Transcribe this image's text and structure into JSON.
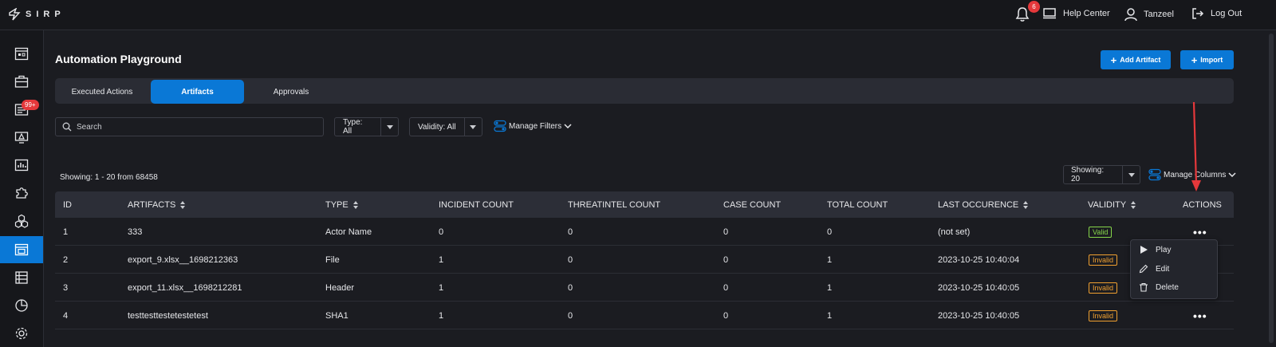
{
  "app": {
    "logo_text": "SIRP"
  },
  "topbar": {
    "notifications_count": "6",
    "help_label": "Help Center",
    "user_name": "Tanzeel",
    "logout_label": "Log Out"
  },
  "sidebar": {
    "badge": "99+"
  },
  "page": {
    "title": "Automation Playground",
    "add_artifact_label": "Add Artifact",
    "import_label": "Import"
  },
  "tabs": [
    {
      "label": "Executed Actions",
      "active": false
    },
    {
      "label": "Artifacts",
      "active": true
    },
    {
      "label": "Approvals",
      "active": false
    }
  ],
  "filters": {
    "search_placeholder": "Search",
    "type_label": "Type: All",
    "validity_label": "Validity: All",
    "manage_filters_label": "Manage Filters"
  },
  "listing": {
    "showing_text": "Showing: 1 - 20 from 68458",
    "page_size_label": "Showing: 20",
    "manage_columns_label": "Manage Columns"
  },
  "table": {
    "columns": [
      "ID",
      "ARTIFACTS",
      "TYPE",
      "INCIDENT COUNT",
      "THREATINTEL COUNT",
      "CASE COUNT",
      "TOTAL COUNT",
      "LAST OCCURENCE",
      "VALIDITY",
      "ACTIONS"
    ],
    "rows": [
      {
        "id": "1",
        "artifact": "333",
        "type": "Actor Name",
        "incident": "0",
        "threatintel": "0",
        "case": "0",
        "total": "0",
        "last": "(not set)",
        "validity": "Valid",
        "actions": "•••"
      },
      {
        "id": "2",
        "artifact": "export_9.xlsx__1698212363",
        "type": "File",
        "incident": "1",
        "threatintel": "0",
        "case": "0",
        "total": "1",
        "last": "2023-10-25 10:40:04",
        "validity": "Invalid",
        "actions": ""
      },
      {
        "id": "3",
        "artifact": "export_11.xlsx__1698212281",
        "type": "Header",
        "incident": "1",
        "threatintel": "0",
        "case": "0",
        "total": "1",
        "last": "2023-10-25 10:40:05",
        "validity": "Invalid",
        "actions": ""
      },
      {
        "id": "4",
        "artifact": "testtesttestetestetest",
        "type": "SHA1",
        "incident": "1",
        "threatintel": "0",
        "case": "0",
        "total": "1",
        "last": "2023-10-25 10:40:05",
        "validity": "Invalid",
        "actions": "•••"
      }
    ]
  },
  "context_menu": {
    "items": [
      {
        "label": "Play",
        "icon": "play-icon"
      },
      {
        "label": "Edit",
        "icon": "pencil-icon"
      },
      {
        "label": "Delete",
        "icon": "trash-icon"
      }
    ]
  },
  "colors": {
    "accent": "#0a78d6",
    "background": "#1b1c21",
    "valid": "#86d64a",
    "invalid": "#f0a030",
    "annotation_arrow": "#e5383b"
  }
}
